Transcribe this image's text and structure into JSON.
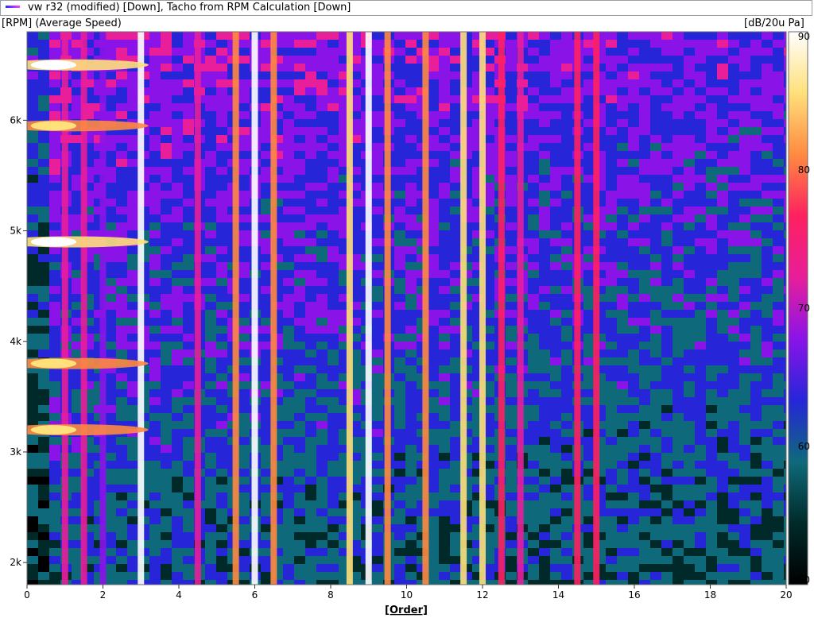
{
  "legend": {
    "series_label": "vw r32 (modified) [Down], Tacho from RPM Calculation [Down]"
  },
  "colorbar": {
    "unit": "[dB/20u Pa]",
    "ticks": [
      "90",
      "80",
      "70",
      "60",
      "50"
    ],
    "colors": [
      "#000000",
      "#002a2a",
      "#0e6a7a",
      "#2626d8",
      "#8a14e8",
      "#e81e9a",
      "#ff2060",
      "#ff8a40",
      "#ffe07a",
      "#ffffff"
    ]
  },
  "chart_data": {
    "type": "heatmap",
    "title": "",
    "xlabel": "[Order]",
    "ylabel": "[RPM] (Average Speed)",
    "xlim": [
      0,
      20
    ],
    "ylim": [
      1800,
      6800
    ],
    "zlim": [
      50,
      90
    ],
    "x_ticks": [
      "0",
      "2",
      "4",
      "6",
      "8",
      "10",
      "12",
      "14",
      "16",
      "18",
      "20"
    ],
    "y_ticks": [
      "2k",
      "3k",
      "4k",
      "5k",
      "6k"
    ],
    "order_lines": [
      {
        "order": 1,
        "level_db": 70
      },
      {
        "order": 1.5,
        "level_db": 72
      },
      {
        "order": 2,
        "level_db": 68
      },
      {
        "order": 3,
        "level_db": 90
      },
      {
        "order": 4.5,
        "level_db": 72
      },
      {
        "order": 5.5,
        "level_db": 82
      },
      {
        "order": 6,
        "level_db": 90
      },
      {
        "order": 6.5,
        "level_db": 80
      },
      {
        "order": 8.5,
        "level_db": 84
      },
      {
        "order": 9,
        "level_db": 88
      },
      {
        "order": 9.5,
        "level_db": 80
      },
      {
        "order": 10.5,
        "level_db": 82
      },
      {
        "order": 11.5,
        "level_db": 84
      },
      {
        "order": 12,
        "level_db": 86
      },
      {
        "order": 12.5,
        "level_db": 78
      },
      {
        "order": 13,
        "level_db": 74
      },
      {
        "order": 14.5,
        "level_db": 76
      },
      {
        "order": 15,
        "level_db": 76
      }
    ],
    "resonance_peaks": [
      {
        "rpm": 6500,
        "level_db": 88
      },
      {
        "rpm": 5950,
        "level_db": 86
      },
      {
        "rpm": 4900,
        "level_db": 88
      },
      {
        "rpm": 3800,
        "level_db": 86
      },
      {
        "rpm": 3200,
        "level_db": 86
      }
    ]
  }
}
